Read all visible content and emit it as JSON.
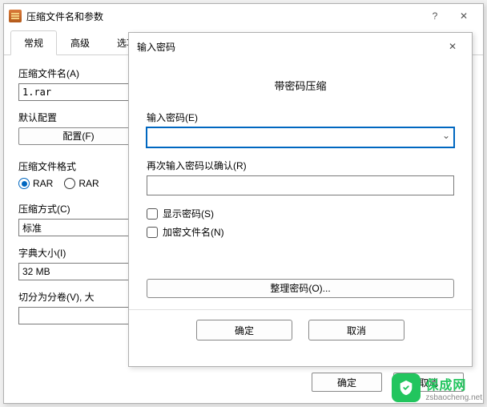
{
  "mainWindow": {
    "title": "压缩文件名和参数",
    "tabs": [
      "常规",
      "高级",
      "选项"
    ],
    "filenameLabel": "压缩文件名(A)",
    "filenameValue": "1.rar",
    "defaultConfigLabel": "默认配置",
    "configBtn": "配置(F)",
    "formatLabel": "压缩文件格式",
    "formatOpts": {
      "rar": "RAR",
      "rar5": "RAR"
    },
    "methodLabel": "压缩方式(C)",
    "methodValue": "标准",
    "dictLabel": "字典大小(I)",
    "dictValue": "32 MB",
    "splitLabel": "切分为分卷(V), 大",
    "okBtn": "确定",
    "cancelBtn": "取消"
  },
  "dialog": {
    "title": "输入密码",
    "heading": "带密码压缩",
    "pwLabel": "输入密码(E)",
    "confirmLabel": "再次输入密码以确认(R)",
    "showPw": "显示密码(S)",
    "encryptNames": "加密文件名(N)",
    "organizeBtn": "整理密码(O)...",
    "okBtn": "确定",
    "cancelBtn": "取消"
  },
  "watermark": {
    "cn": "保成网",
    "en": "zsbaocheng.net"
  },
  "glyph": {
    "help": "?",
    "close": "✕",
    "chev": "⌄"
  }
}
